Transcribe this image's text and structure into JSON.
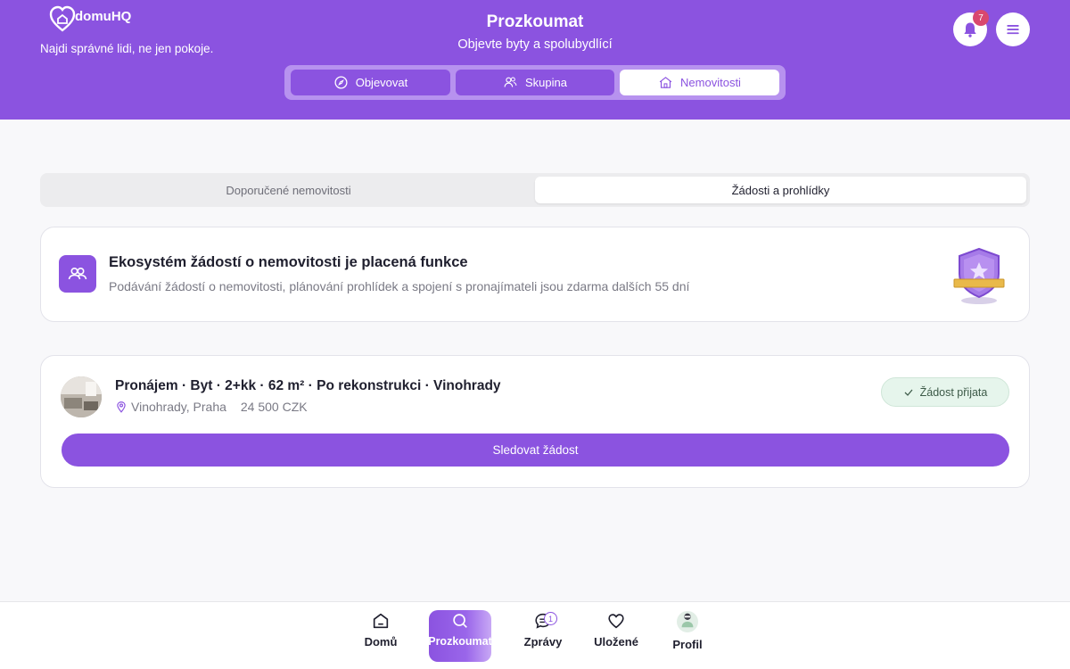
{
  "header": {
    "logo_text": "domuHQ",
    "tagline": "Najdi správné lidi, ne jen pokoje.",
    "title": "Prozkoumat",
    "subtitle": "Objevte byty a spolubydlící",
    "notification_count": "7",
    "tabs": [
      {
        "label": "Objevovat",
        "icon": "compass-icon"
      },
      {
        "label": "Skupina",
        "icon": "users-icon"
      },
      {
        "label": "Nemovitosti",
        "icon": "house-icon",
        "active": true
      }
    ]
  },
  "subtabs": {
    "left": "Doporučené nemovitosti",
    "right": "Žádosti a prohlídky",
    "active": "right"
  },
  "premium": {
    "title": "Ekosystém žádostí o nemovitosti je placená funkce",
    "description": "Podávání žádostí o nemovitosti, plánování prohlídek a spojení s pronajímateli jsou zdarma dalších 55 dní",
    "badge_icon": "premium-shield-icon"
  },
  "listing": {
    "title": "Pronájem · Byt · 2+kk · 62 m² · Po rekonstrukci · Vinohrady",
    "location": "Vinohrady, Praha",
    "price": "24 500 CZK",
    "status": "Žádost přijata",
    "action": "Sledovat žádost"
  },
  "bottom_nav": {
    "items": [
      {
        "label": "Domů",
        "icon": "home-icon"
      },
      {
        "label": "Prozkoumat",
        "icon": "search-icon",
        "active": true
      },
      {
        "label": "Zprávy",
        "icon": "chat-icon",
        "badge": "1"
      },
      {
        "label": "Uložené",
        "icon": "heart-icon"
      },
      {
        "label": "Profil",
        "icon": "avatar"
      }
    ]
  },
  "colors": {
    "brand": "#8b53e0",
    "status_bg": "#e6f5ec",
    "badge": "#d9486f"
  }
}
